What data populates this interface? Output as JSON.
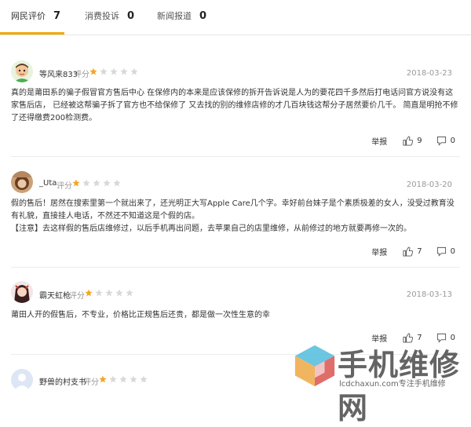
{
  "tabs": [
    {
      "label": "网民评价",
      "count": "7",
      "active": true
    },
    {
      "label": "消费投诉",
      "count": "0",
      "active": false
    },
    {
      "label": "新闻报道",
      "count": "0",
      "active": false
    }
  ],
  "rating_label": "评分",
  "actions": {
    "report": "举报"
  },
  "reviews": [
    {
      "user": "等风来833",
      "date": "2018-03-23",
      "stars": 1,
      "content": [
        "真的是莆田系的骗子假冒官方售后中心 在保修内的本来是应该保修的拆开告诉说是人为的要花四千多然后打电话问官方说没有这家售后店， 已经被这帮骗子拆了官方也不给保修了 又去找的别的维修店修的才几百块钱这帮分子居然要价几千。 简直是明抢不修了还得缴费200检测费。"
      ],
      "likes": "9",
      "comments": "0"
    },
    {
      "user": "_Uta",
      "date": "2018-03-20",
      "stars": 1,
      "content": [
        "假的售后！居然在搜索里第一个就出来了，还光明正大写Apple Care几个字。幸好前台妹子是个素质极差的女人，没受过教育没有礼貌，直接挂人电话，不然还不知道这是个假的店。",
        "【注意】去这样假的售后店维修过，以后手机再出问题，去苹果自己的店里维修，从前修过的地方就要再修一次的。"
      ],
      "likes": "7",
      "comments": "0"
    },
    {
      "user": "霸天虹枪",
      "date": "2018-03-13",
      "stars": 1,
      "content": [
        "莆田人开的假售后，不专业，价格比正规售后还贵，都是做一次性生意的幸"
      ],
      "likes": "7",
      "comments": "0"
    },
    {
      "user": "野兽的村支书",
      "date": "",
      "stars": 1,
      "content": [],
      "likes": "",
      "comments": ""
    }
  ],
  "watermark": {
    "title": "手机维修网",
    "subtitle": "lcdchaxun.com专注手机维修"
  },
  "colors": {
    "accent": "#f0a900",
    "star_on": "#f5a623",
    "star_off": "#d8d8d8"
  }
}
